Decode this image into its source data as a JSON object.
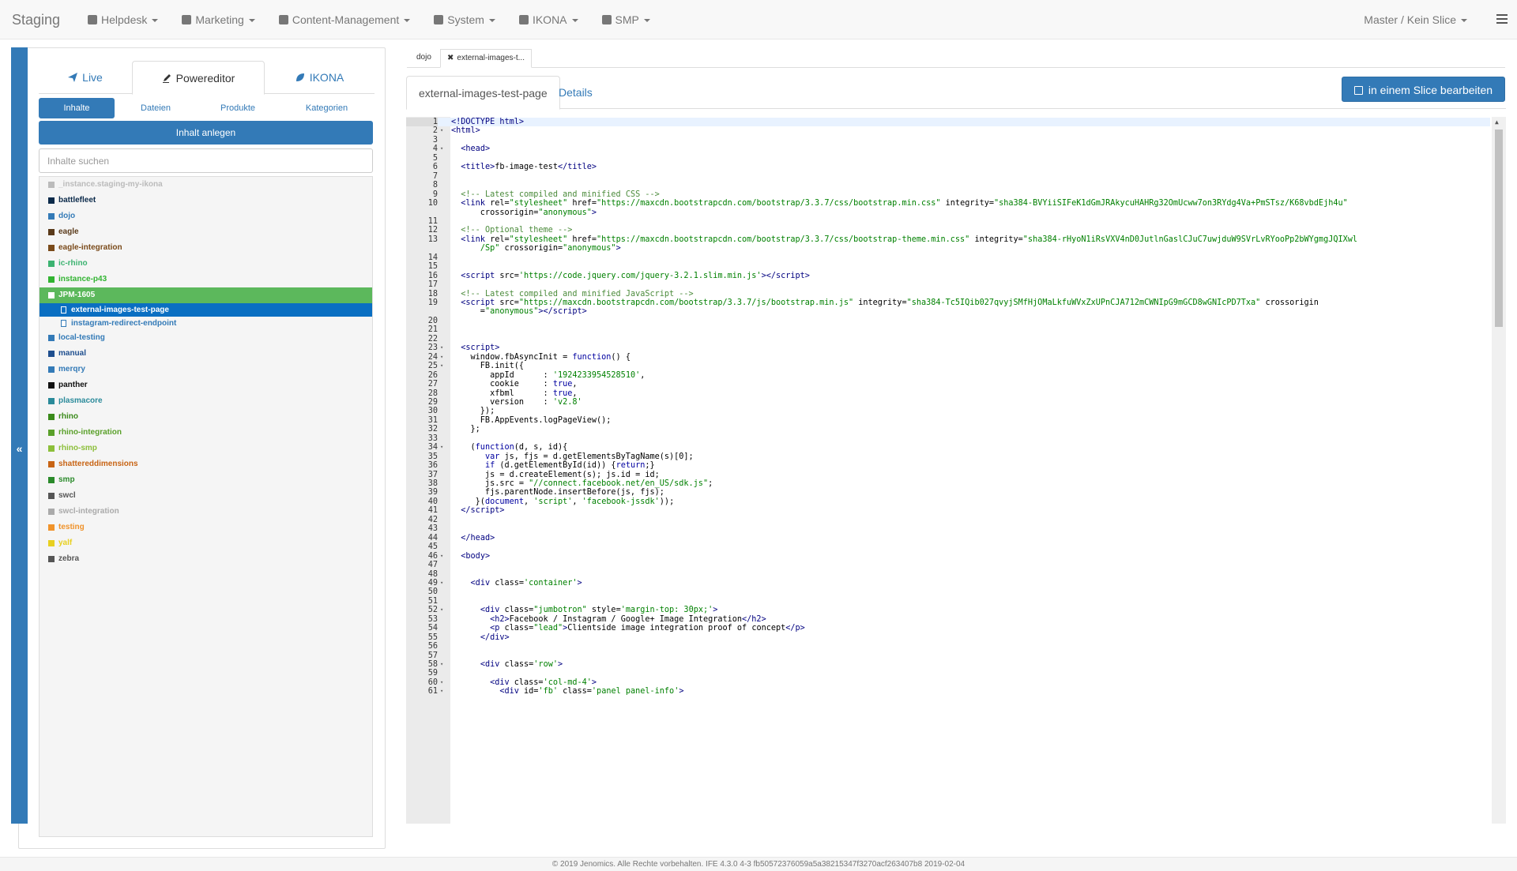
{
  "app": {
    "brand": "Staging"
  },
  "nav": {
    "items": [
      {
        "label": "Helpdesk",
        "icon": "users-icon"
      },
      {
        "label": "Marketing",
        "icon": "bar-chart-icon"
      },
      {
        "label": "Content-Management",
        "icon": "book-icon"
      },
      {
        "label": "System",
        "icon": "gears-icon"
      },
      {
        "label": "IKONA",
        "icon": "leaf-icon"
      },
      {
        "label": "SMP",
        "icon": "cube-icon"
      }
    ],
    "right_label": "Master / Kein Slice"
  },
  "left": {
    "tabs": [
      {
        "label": "Live",
        "icon": "send-icon"
      },
      {
        "label": "Powereditor",
        "icon": "pen-icon"
      },
      {
        "label": "IKONA",
        "icon": "leaf-icon"
      }
    ],
    "subtabs": [
      "Inhalte",
      "Dateien",
      "Produkte",
      "Kategorien"
    ],
    "create_button": "Inhalt anlegen",
    "search_placeholder": "Inhalte suchen",
    "tree": [
      {
        "label": "_instance.staging-my-ikona",
        "color": "#bbbbbb"
      },
      {
        "label": "battlefleet",
        "color": "#0b2a4a"
      },
      {
        "label": "dojo",
        "color": "#337ab7"
      },
      {
        "label": "eagle",
        "color": "#5a3a1a"
      },
      {
        "label": "eagle-integration",
        "color": "#7a4a1a"
      },
      {
        "label": "ic-rhino",
        "color": "#3cb371"
      },
      {
        "label": "instance-p43",
        "color": "#32b432"
      },
      {
        "label": "JPM-1605",
        "color": "#5cb85c",
        "selected": true
      },
      {
        "label": "local-testing",
        "color": "#337ab7"
      },
      {
        "label": "manual",
        "color": "#1f4f8f"
      },
      {
        "label": "merqry",
        "color": "#337ab7"
      },
      {
        "label": "panther",
        "color": "#111111"
      },
      {
        "label": "plasmacore",
        "color": "#2a8a9a"
      },
      {
        "label": "rhino",
        "color": "#3a8a1a"
      },
      {
        "label": "rhino-integration",
        "color": "#5aa02a"
      },
      {
        "label": "rhino-smp",
        "color": "#8cbf3a"
      },
      {
        "label": "shattereddimensions",
        "color": "#c86414"
      },
      {
        "label": "smp",
        "color": "#2a8a2a"
      },
      {
        "label": "swcl",
        "color": "#555555"
      },
      {
        "label": "swcl-integration",
        "color": "#aaaaaa"
      },
      {
        "label": "testing",
        "color": "#f0932b"
      },
      {
        "label": "yalf",
        "color": "#e8d020"
      },
      {
        "label": "zebra",
        "color": "#555555"
      }
    ],
    "children": [
      "external-images-test-page",
      "instagram-redirect-endpoint"
    ]
  },
  "editor": {
    "doc_tabs": [
      "dojo",
      "external-images-t..."
    ],
    "page_tabs": [
      "external-images-test-page",
      "Details"
    ],
    "slice_button": "in einem Slice bearbeiten",
    "lines": [
      {
        "n": "1",
        "f": "",
        "h": "<span class=\"tg\">&lt;!DOCTYPE html&gt;</span>"
      },
      {
        "n": "2",
        "f": "▾",
        "h": "<span class=\"tg\">&lt;html&gt;</span>"
      },
      {
        "n": "3",
        "f": "",
        "h": ""
      },
      {
        "n": "4",
        "f": "▾",
        "h": "  <span class=\"tg\">&lt;head&gt;</span>"
      },
      {
        "n": "5",
        "f": "",
        "h": ""
      },
      {
        "n": "6",
        "f": "",
        "h": "  <span class=\"tg\">&lt;title&gt;</span>fb-image-test<span class=\"tg\">&lt;/title&gt;</span>"
      },
      {
        "n": "7",
        "f": "",
        "h": ""
      },
      {
        "n": "8",
        "f": "",
        "h": ""
      },
      {
        "n": "9",
        "f": "",
        "h": "  <span class=\"cm\">&lt;!-- Latest compiled and minified CSS --&gt;</span>"
      },
      {
        "n": "10",
        "f": "",
        "h": "  <span class=\"tg\">&lt;link</span> rel=<span class=\"st\">\"stylesheet\"</span> href=<span class=\"st\">\"https://maxcdn.bootstrapcdn.com/bootstrap/3.3.7/css/bootstrap.min.css\"</span> integrity=<span class=\"st\">\"sha384-BVYiiSIFeK1dGmJRAkycuHAHRg32OmUcww7on3RYdg4Va+PmSTsz/K68vbdEjh4u\"</span>"
      },
      {
        "n": "",
        "f": "",
        "h": "      crossorigin=<span class=\"st\">\"anonymous\"</span><span class=\"tg\">&gt;</span>"
      },
      {
        "n": "11",
        "f": "",
        "h": ""
      },
      {
        "n": "12",
        "f": "",
        "h": "  <span class=\"cm\">&lt;!-- Optional theme --&gt;</span>"
      },
      {
        "n": "13",
        "f": "",
        "h": "  <span class=\"tg\">&lt;link</span> rel=<span class=\"st\">\"stylesheet\"</span> href=<span class=\"st\">\"https://maxcdn.bootstrapcdn.com/bootstrap/3.3.7/css/bootstrap-theme.min.css\"</span> integrity=<span class=\"st\">\"sha384-rHyoN1iRsVXV4nD0JutlnGaslCJuC7uwjduW9SVrLvRYooPp2bWYgmgJQIXwl</span>"
      },
      {
        "n": "",
        "f": "",
        "h": "      <span class=\"st\">/Sp\"</span> crossorigin=<span class=\"st\">\"anonymous\"</span><span class=\"tg\">&gt;</span>"
      },
      {
        "n": "14",
        "f": "",
        "h": ""
      },
      {
        "n": "15",
        "f": "",
        "h": ""
      },
      {
        "n": "16",
        "f": "",
        "h": "  <span class=\"tg\">&lt;script</span> src=<span class=\"st\">'https://code.jquery.com/jquery-3.2.1.slim.min.js'</span><span class=\"tg\">&gt;&lt;/script&gt;</span>"
      },
      {
        "n": "17",
        "f": "",
        "h": ""
      },
      {
        "n": "18",
        "f": "",
        "h": "  <span class=\"cm\">&lt;!-- Latest compiled and minified JavaScript --&gt;</span>"
      },
      {
        "n": "19",
        "f": "",
        "h": "  <span class=\"tg\">&lt;script</span> src=<span class=\"st\">\"https://maxcdn.bootstrapcdn.com/bootstrap/3.3.7/js/bootstrap.min.js\"</span> integrity=<span class=\"st\">\"sha384-Tc5IQib027qvyjSMfHjOMaLkfuWVxZxUPnCJA712mCWNIpG9mGCD8wGNIcPD7Txa\"</span> crossorigin"
      },
      {
        "n": "",
        "f": "",
        "h": "      =<span class=\"st\">\"anonymous\"</span><span class=\"tg\">&gt;&lt;/script&gt;</span>"
      },
      {
        "n": "20",
        "f": "",
        "h": ""
      },
      {
        "n": "21",
        "f": "",
        "h": ""
      },
      {
        "n": "22",
        "f": "",
        "h": ""
      },
      {
        "n": "23",
        "f": "▾",
        "h": "  <span class=\"tg\">&lt;script&gt;</span>"
      },
      {
        "n": "24",
        "f": "▾",
        "h": "    window.fbAsyncInit = <span class=\"kw\">function</span>() {"
      },
      {
        "n": "25",
        "f": "▾",
        "h": "      FB.init({"
      },
      {
        "n": "26",
        "f": "",
        "h": "        appId      : <span class=\"st\">'1924233954528510'</span>,"
      },
      {
        "n": "27",
        "f": "",
        "h": "        cookie     : <span class=\"kw\">true</span>,"
      },
      {
        "n": "28",
        "f": "",
        "h": "        xfbml      : <span class=\"kw\">true</span>,"
      },
      {
        "n": "29",
        "f": "",
        "h": "        version    : <span class=\"st\">'v2.8'</span>"
      },
      {
        "n": "30",
        "f": "",
        "h": "      });"
      },
      {
        "n": "31",
        "f": "",
        "h": "      FB.AppEvents.logPageView();"
      },
      {
        "n": "32",
        "f": "",
        "h": "    };"
      },
      {
        "n": "33",
        "f": "",
        "h": ""
      },
      {
        "n": "34",
        "f": "▾",
        "h": "    (<span class=\"kw\">function</span>(d, s, id){"
      },
      {
        "n": "35",
        "f": "",
        "h": "       <span class=\"kw\">var</span> js, fjs = d.getElementsByTagName(s)[0];"
      },
      {
        "n": "36",
        "f": "",
        "h": "       <span class=\"kw\">if</span> (d.getElementById(id)) {<span class=\"kw\">return</span>;}"
      },
      {
        "n": "37",
        "f": "",
        "h": "       js = d.createElement(s); js.id = id;"
      },
      {
        "n": "38",
        "f": "",
        "h": "       js.src = <span class=\"st\">\"//connect.facebook.net/en_US/sdk.js\"</span>;"
      },
      {
        "n": "39",
        "f": "",
        "h": "       fjs.parentNode.insertBefore(js, fjs);"
      },
      {
        "n": "40",
        "f": "",
        "h": "     }(<span class=\"kw\">document</span>, <span class=\"st\">'script'</span>, <span class=\"st\">'facebook-jssdk'</span>));"
      },
      {
        "n": "41",
        "f": "",
        "h": "  <span class=\"tg\">&lt;/script&gt;</span>"
      },
      {
        "n": "42",
        "f": "",
        "h": ""
      },
      {
        "n": "43",
        "f": "",
        "h": ""
      },
      {
        "n": "44",
        "f": "",
        "h": "  <span class=\"tg\">&lt;/head&gt;</span>"
      },
      {
        "n": "45",
        "f": "",
        "h": ""
      },
      {
        "n": "46",
        "f": "▾",
        "h": "  <span class=\"tg\">&lt;body&gt;</span>"
      },
      {
        "n": "47",
        "f": "",
        "h": ""
      },
      {
        "n": "48",
        "f": "",
        "h": ""
      },
      {
        "n": "49",
        "f": "▾",
        "h": "    <span class=\"tg\">&lt;div</span> class=<span class=\"st\">'container'</span><span class=\"tg\">&gt;</span>"
      },
      {
        "n": "50",
        "f": "",
        "h": ""
      },
      {
        "n": "51",
        "f": "",
        "h": ""
      },
      {
        "n": "52",
        "f": "▾",
        "h": "      <span class=\"tg\">&lt;div</span> class=<span class=\"st\">\"jumbotron\"</span> style=<span class=\"st\">'margin-top: 30px;'</span><span class=\"tg\">&gt;</span>"
      },
      {
        "n": "53",
        "f": "",
        "h": "        <span class=\"tg\">&lt;h2&gt;</span>Facebook / Instagram / Google+ Image Integration<span class=\"tg\">&lt;/h2&gt;</span>"
      },
      {
        "n": "54",
        "f": "",
        "h": "        <span class=\"tg\">&lt;p</span> class=<span class=\"st\">\"lead\"</span><span class=\"tg\">&gt;</span>Clientside image integration proof of concept<span class=\"tg\">&lt;/p&gt;</span>"
      },
      {
        "n": "55",
        "f": "",
        "h": "      <span class=\"tg\">&lt;/div&gt;</span>"
      },
      {
        "n": "56",
        "f": "",
        "h": ""
      },
      {
        "n": "57",
        "f": "",
        "h": ""
      },
      {
        "n": "58",
        "f": "▾",
        "h": "      <span class=\"tg\">&lt;div</span> class=<span class=\"st\">'row'</span><span class=\"tg\">&gt;</span>"
      },
      {
        "n": "59",
        "f": "",
        "h": ""
      },
      {
        "n": "60",
        "f": "▾",
        "h": "        <span class=\"tg\">&lt;div</span> class=<span class=\"st\">'col-md-4'</span><span class=\"tg\">&gt;</span>"
      },
      {
        "n": "61",
        "f": "▾",
        "h": "          <span class=\"tg\">&lt;div</span> id=<span class=\"st\">'fb'</span> class=<span class=\"st\">'panel panel-info'</span><span class=\"tg\">&gt;</span>"
      }
    ]
  },
  "footer": "© 2019 Jenomics. Alle Rechte vorbehalten. IFE 4.3.0 4-3 fb50572376059a5a38215347f3270acf263407b8 2019-02-04"
}
